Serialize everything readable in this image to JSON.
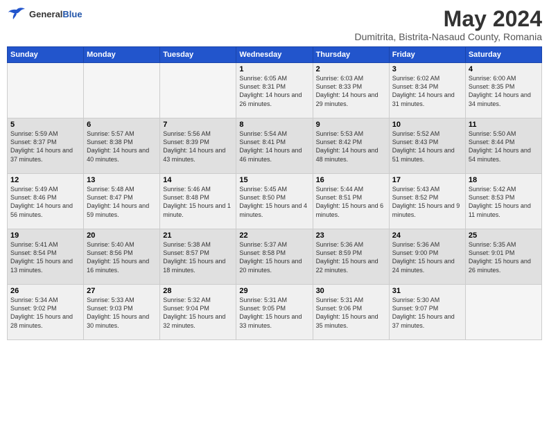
{
  "header": {
    "logo_general": "General",
    "logo_blue": "Blue",
    "month_year": "May 2024",
    "location": "Dumitrita, Bistrita-Nasaud County, Romania"
  },
  "weekdays": [
    "Sunday",
    "Monday",
    "Tuesday",
    "Wednesday",
    "Thursday",
    "Friday",
    "Saturday"
  ],
  "weeks": [
    [
      {
        "day": "",
        "info": ""
      },
      {
        "day": "",
        "info": ""
      },
      {
        "day": "",
        "info": ""
      },
      {
        "day": "1",
        "info": "Sunrise: 6:05 AM\nSunset: 8:31 PM\nDaylight: 14 hours\nand 26 minutes."
      },
      {
        "day": "2",
        "info": "Sunrise: 6:03 AM\nSunset: 8:33 PM\nDaylight: 14 hours\nand 29 minutes."
      },
      {
        "day": "3",
        "info": "Sunrise: 6:02 AM\nSunset: 8:34 PM\nDaylight: 14 hours\nand 31 minutes."
      },
      {
        "day": "4",
        "info": "Sunrise: 6:00 AM\nSunset: 8:35 PM\nDaylight: 14 hours\nand 34 minutes."
      }
    ],
    [
      {
        "day": "5",
        "info": "Sunrise: 5:59 AM\nSunset: 8:37 PM\nDaylight: 14 hours\nand 37 minutes."
      },
      {
        "day": "6",
        "info": "Sunrise: 5:57 AM\nSunset: 8:38 PM\nDaylight: 14 hours\nand 40 minutes."
      },
      {
        "day": "7",
        "info": "Sunrise: 5:56 AM\nSunset: 8:39 PM\nDaylight: 14 hours\nand 43 minutes."
      },
      {
        "day": "8",
        "info": "Sunrise: 5:54 AM\nSunset: 8:41 PM\nDaylight: 14 hours\nand 46 minutes."
      },
      {
        "day": "9",
        "info": "Sunrise: 5:53 AM\nSunset: 8:42 PM\nDaylight: 14 hours\nand 48 minutes."
      },
      {
        "day": "10",
        "info": "Sunrise: 5:52 AM\nSunset: 8:43 PM\nDaylight: 14 hours\nand 51 minutes."
      },
      {
        "day": "11",
        "info": "Sunrise: 5:50 AM\nSunset: 8:44 PM\nDaylight: 14 hours\nand 54 minutes."
      }
    ],
    [
      {
        "day": "12",
        "info": "Sunrise: 5:49 AM\nSunset: 8:46 PM\nDaylight: 14 hours\nand 56 minutes."
      },
      {
        "day": "13",
        "info": "Sunrise: 5:48 AM\nSunset: 8:47 PM\nDaylight: 14 hours\nand 59 minutes."
      },
      {
        "day": "14",
        "info": "Sunrise: 5:46 AM\nSunset: 8:48 PM\nDaylight: 15 hours\nand 1 minute."
      },
      {
        "day": "15",
        "info": "Sunrise: 5:45 AM\nSunset: 8:50 PM\nDaylight: 15 hours\nand 4 minutes."
      },
      {
        "day": "16",
        "info": "Sunrise: 5:44 AM\nSunset: 8:51 PM\nDaylight: 15 hours\nand 6 minutes."
      },
      {
        "day": "17",
        "info": "Sunrise: 5:43 AM\nSunset: 8:52 PM\nDaylight: 15 hours\nand 9 minutes."
      },
      {
        "day": "18",
        "info": "Sunrise: 5:42 AM\nSunset: 8:53 PM\nDaylight: 15 hours\nand 11 minutes."
      }
    ],
    [
      {
        "day": "19",
        "info": "Sunrise: 5:41 AM\nSunset: 8:54 PM\nDaylight: 15 hours\nand 13 minutes."
      },
      {
        "day": "20",
        "info": "Sunrise: 5:40 AM\nSunset: 8:56 PM\nDaylight: 15 hours\nand 16 minutes."
      },
      {
        "day": "21",
        "info": "Sunrise: 5:38 AM\nSunset: 8:57 PM\nDaylight: 15 hours\nand 18 minutes."
      },
      {
        "day": "22",
        "info": "Sunrise: 5:37 AM\nSunset: 8:58 PM\nDaylight: 15 hours\nand 20 minutes."
      },
      {
        "day": "23",
        "info": "Sunrise: 5:36 AM\nSunset: 8:59 PM\nDaylight: 15 hours\nand 22 minutes."
      },
      {
        "day": "24",
        "info": "Sunrise: 5:36 AM\nSunset: 9:00 PM\nDaylight: 15 hours\nand 24 minutes."
      },
      {
        "day": "25",
        "info": "Sunrise: 5:35 AM\nSunset: 9:01 PM\nDaylight: 15 hours\nand 26 minutes."
      }
    ],
    [
      {
        "day": "26",
        "info": "Sunrise: 5:34 AM\nSunset: 9:02 PM\nDaylight: 15 hours\nand 28 minutes."
      },
      {
        "day": "27",
        "info": "Sunrise: 5:33 AM\nSunset: 9:03 PM\nDaylight: 15 hours\nand 30 minutes."
      },
      {
        "day": "28",
        "info": "Sunrise: 5:32 AM\nSunset: 9:04 PM\nDaylight: 15 hours\nand 32 minutes."
      },
      {
        "day": "29",
        "info": "Sunrise: 5:31 AM\nSunset: 9:05 PM\nDaylight: 15 hours\nand 33 minutes."
      },
      {
        "day": "30",
        "info": "Sunrise: 5:31 AM\nSunset: 9:06 PM\nDaylight: 15 hours\nand 35 minutes."
      },
      {
        "day": "31",
        "info": "Sunrise: 5:30 AM\nSunset: 9:07 PM\nDaylight: 15 hours\nand 37 minutes."
      },
      {
        "day": "",
        "info": ""
      }
    ]
  ]
}
